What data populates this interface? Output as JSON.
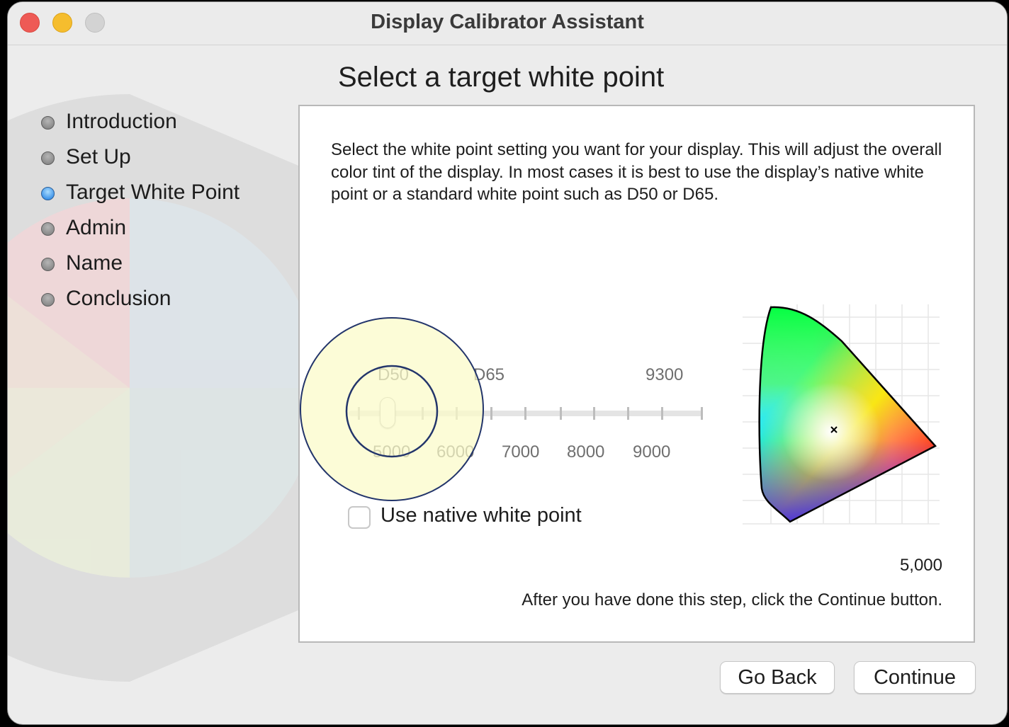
{
  "window": {
    "title": "Display Calibrator Assistant"
  },
  "page": {
    "heading": "Select a target white point"
  },
  "sidebar": {
    "steps": [
      {
        "label": "Introduction",
        "state": "done"
      },
      {
        "label": "Set Up",
        "state": "done"
      },
      {
        "label": "Target White Point",
        "state": "current"
      },
      {
        "label": "Admin",
        "state": "pending"
      },
      {
        "label": "Name",
        "state": "pending"
      },
      {
        "label": "Conclusion",
        "state": "pending"
      }
    ]
  },
  "panel": {
    "description": "Select the white point setting you want for your display.  This will adjust the overall color tint of the display.  In most cases it is best to use the display’s native white point or a standard white point such as D50 or D65.",
    "slider": {
      "top_labels": [
        "D50",
        "D65",
        "9300"
      ],
      "bottom_labels": [
        "5000",
        "6000",
        "7000",
        "8000",
        "9000"
      ],
      "value": 5000,
      "min": 4500,
      "max": 9500
    },
    "native_checkbox": {
      "label": "Use native white point",
      "checked": false
    },
    "kelvin_value": "5,000",
    "footer_note": "After you have done this step, click the Continue button."
  },
  "buttons": {
    "back": "Go Back",
    "continue": "Continue"
  },
  "colors": {
    "accent_step": "#1779e0",
    "highlight_fill": "#fbfbc8",
    "highlight_stroke": "#23356b"
  },
  "icons": {
    "step_dot": "circle-dot-icon",
    "gamut": "cie-chromaticity-diagram-icon",
    "white_point_marker": "x-marker-icon"
  }
}
